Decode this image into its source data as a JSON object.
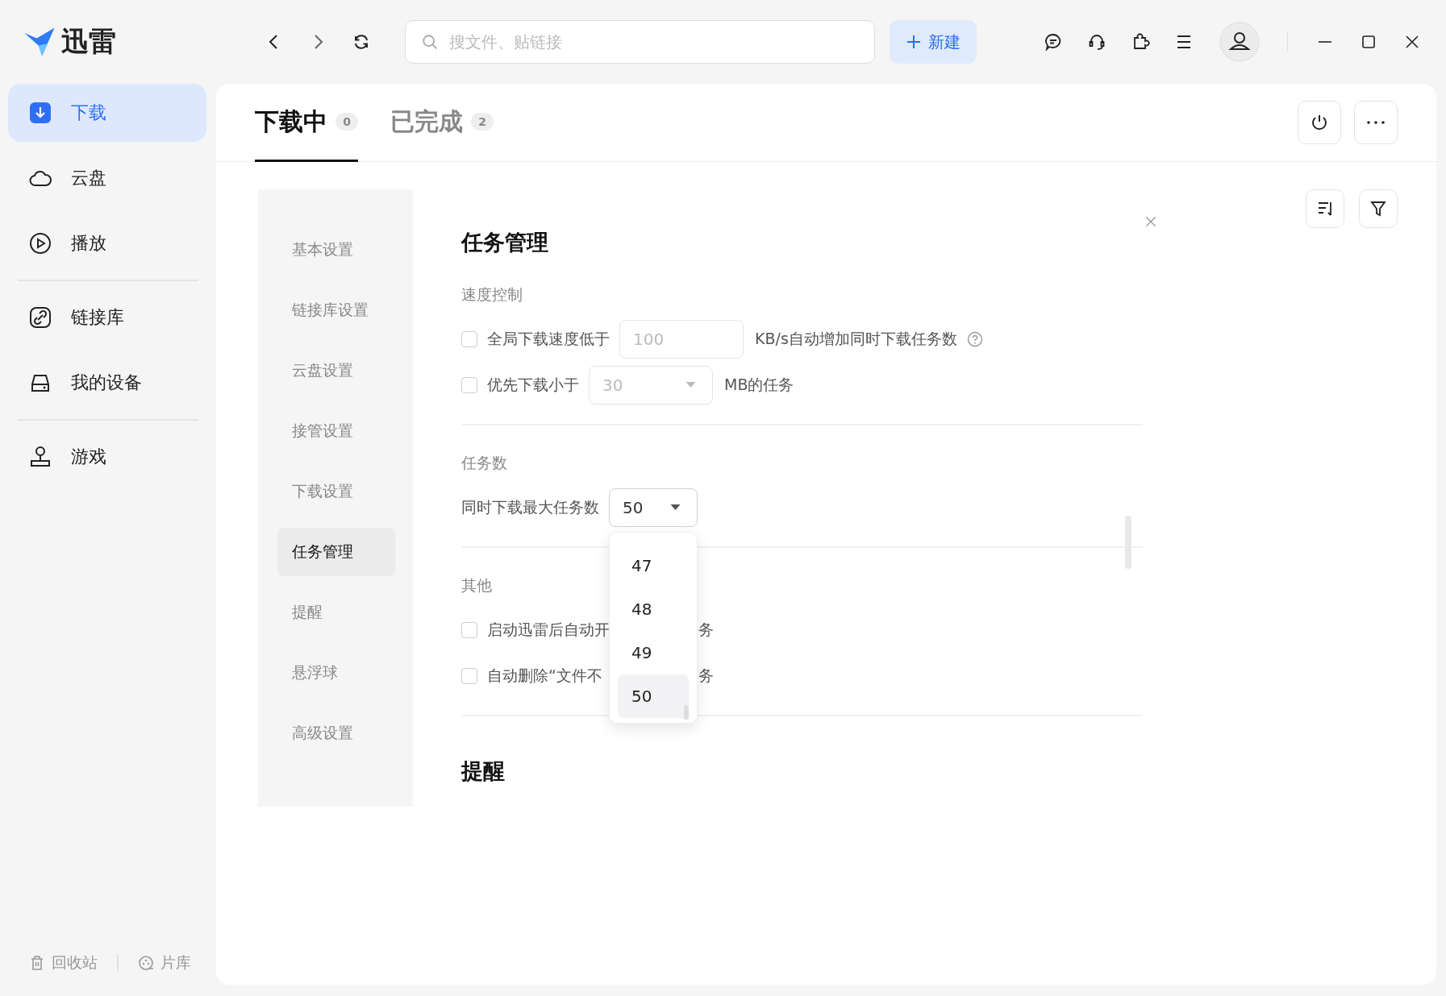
{
  "app": {
    "logo_text": "迅雷"
  },
  "toolbar": {
    "search_placeholder": "搜文件、贴链接",
    "new_button": "新建"
  },
  "sidebar": {
    "groups": [
      [
        {
          "label": "下载",
          "selected": true
        },
        {
          "label": "云盘",
          "selected": false
        },
        {
          "label": "播放",
          "selected": false
        }
      ],
      [
        {
          "label": "链接库",
          "selected": false
        },
        {
          "label": "我的设备",
          "selected": false
        }
      ],
      [
        {
          "label": "游戏",
          "selected": false
        }
      ]
    ],
    "footer": [
      {
        "label": "回收站"
      },
      {
        "label": "片库"
      }
    ]
  },
  "tabs": [
    {
      "label": "下载中",
      "count": "0",
      "selected": true
    },
    {
      "label": "已完成",
      "count": "2",
      "selected": false
    }
  ],
  "settings": {
    "nav": [
      {
        "label": "基本设置",
        "selected": false
      },
      {
        "label": "链接库设置",
        "selected": false
      },
      {
        "label": "云盘设置",
        "selected": false
      },
      {
        "label": "接管设置",
        "selected": false
      },
      {
        "label": "下载设置",
        "selected": false
      },
      {
        "label": "任务管理",
        "selected": true
      },
      {
        "label": "提醒",
        "selected": false
      },
      {
        "label": "悬浮球",
        "selected": false
      },
      {
        "label": "高级设置",
        "selected": false
      }
    ],
    "title": "任务管理",
    "sections": [
      {
        "heading": "速度控制",
        "rows": [
          {
            "kind": "input",
            "checked": false,
            "label": "全局下载速度低于",
            "value": "100",
            "disabled": true,
            "suffix": "KB/s自动增加同时下载任务数",
            "help": true
          },
          {
            "kind": "select",
            "checked": false,
            "label": "优先下载小于",
            "value": "30",
            "disabled": true,
            "suffix": "MB的任务"
          }
        ]
      },
      {
        "heading": "任务数",
        "rows": [
          {
            "kind": "dropdown",
            "label": "同时下载最大任务数",
            "value": "50",
            "expanded": true,
            "options": [
              {
                "label": "47",
                "selected": false
              },
              {
                "label": "48",
                "selected": false
              },
              {
                "label": "49",
                "selected": false
              },
              {
                "label": "50",
                "selected": true
              }
            ]
          }
        ]
      },
      {
        "heading": "其他",
        "rows": [
          {
            "kind": "checkbox",
            "checked": false,
            "label": "启动迅雷后自动开",
            "tail": "务"
          },
          {
            "kind": "checkbox",
            "checked": false,
            "label": "自动删除“文件不",
            "tail": "务"
          }
        ]
      }
    ],
    "next_title": "提醒"
  }
}
